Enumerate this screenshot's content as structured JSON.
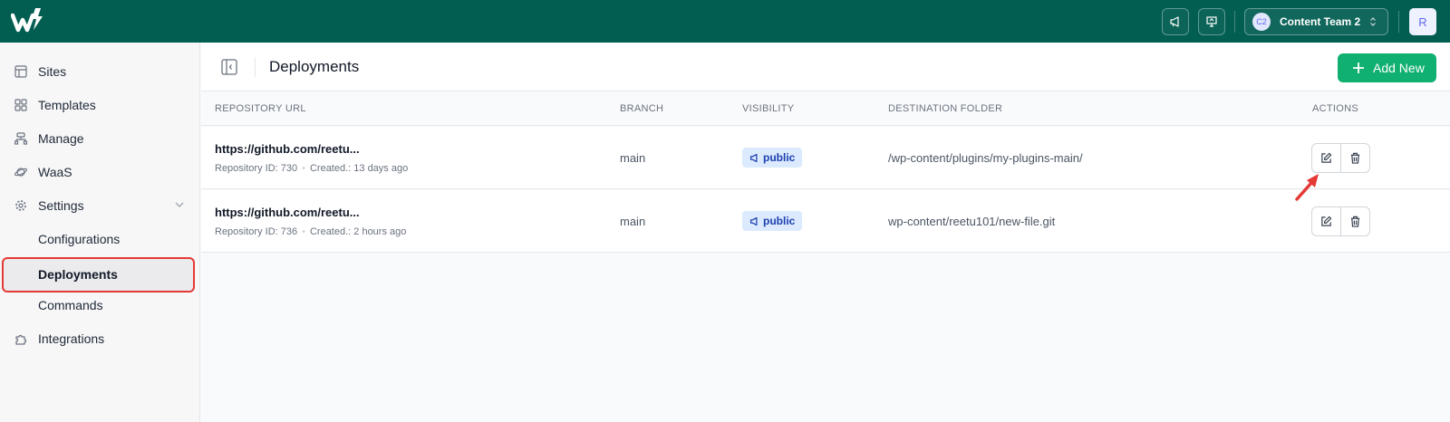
{
  "topbar": {
    "logo_icon": "w-logo-icon",
    "announcements_icon": "megaphone-icon",
    "presentation_icon": "presentation-icon",
    "team": {
      "avatar": "C2",
      "name": "Content Team 2"
    },
    "user_avatar": "R",
    "colors": {
      "background": "#035e52"
    }
  },
  "sidebar": {
    "items": [
      {
        "label": "Sites",
        "icon": "layout-icon"
      },
      {
        "label": "Templates",
        "icon": "grid-icon"
      },
      {
        "label": "Manage",
        "icon": "network-icon"
      },
      {
        "label": "WaaS",
        "icon": "planet-icon"
      },
      {
        "label": "Settings",
        "icon": "gear-icon",
        "expanded": true
      }
    ],
    "settings_children": [
      "Configurations",
      "Deployments",
      "Commands"
    ],
    "active": "Deployments",
    "bottom_item": {
      "label": "Integrations",
      "icon": "puzzle-icon"
    }
  },
  "header": {
    "title": "Deployments",
    "add_button": "Add New",
    "colors": {
      "add_button": "#10b070"
    }
  },
  "table": {
    "columns": [
      "REPOSITORY URL",
      "BRANCH",
      "VISIBILITY",
      "DESTINATION FOLDER",
      "ACTIONS"
    ],
    "rows": [
      {
        "url": "https://github.com/reetu...",
        "repo_id": "Repository ID: 730",
        "created": "Created.: 13 days ago",
        "branch": "main",
        "visibility": "public",
        "destination": "/wp-content/plugins/my-plugins-main/"
      },
      {
        "url": "https://github.com/reetu...",
        "repo_id": "Repository ID: 736",
        "created": "Created.: 2 hours ago",
        "branch": "main",
        "visibility": "public",
        "destination": "wp-content/reetu101/new-file.git"
      }
    ]
  }
}
